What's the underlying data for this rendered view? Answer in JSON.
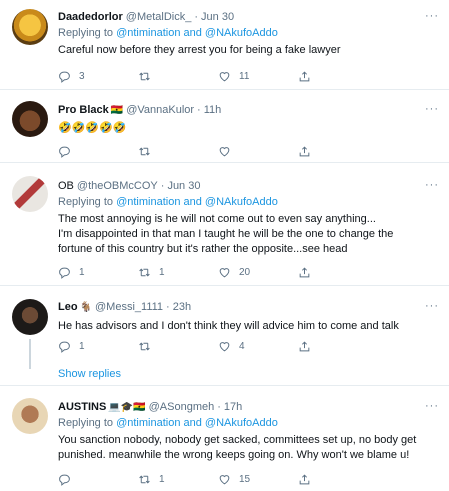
{
  "tweets": [
    {
      "name": "Daadedorlor",
      "handle": "@MetalDick_",
      "dot": "·",
      "date": "Jun 30",
      "replying_prefix": "Replying to ",
      "replying_to": "@ntimination and @NAkufoAddo",
      "text": "Careful now before they arrest you for being a fake lawyer",
      "replies": "3",
      "retweets": "",
      "likes": "11"
    },
    {
      "name": "Pro Black",
      "name_emoji": "🇬🇭",
      "handle": "@VannaKulor",
      "dot": "·",
      "date": "11h",
      "text": "🤣🤣🤣🤣🤣",
      "replies": "",
      "retweets": "",
      "likes": ""
    },
    {
      "name": "OB",
      "handle": "@theOBMcCOY",
      "dot": "·",
      "date": "Jun 30",
      "replying_prefix": "Replying to ",
      "replying_to": "@ntimination and @NAkufoAddo",
      "text_lines": [
        "The most annoying is he will not come out to even say anything...",
        "I'm disappointed in that man I taught he will be the one to change the",
        "fortune of this country but it's rather the opposite...see head"
      ],
      "replies": "1",
      "retweets": "1",
      "likes": "20"
    },
    {
      "name": "Leo",
      "name_emoji": "🐐",
      "handle": "@Messi_1111",
      "dot": "·",
      "date": "23h",
      "text": "He has advisors and I don't think they will advice him to come and talk",
      "replies": "1",
      "retweets": "",
      "likes": "4"
    },
    {
      "name": "AUSTINS",
      "name_emoji": "💻🎓🇬🇭",
      "handle": "@ASongmeh",
      "dot": "·",
      "date": "17h",
      "replying_prefix": "Replying to ",
      "replying_to": "@ntimination and @NAkufoAddo",
      "text_lines": [
        "You sanction nobody, nobody get sacked, committees set up, no body get",
        "punished. meanwhile the wrong keeps going on. Why won't we  blame u!"
      ],
      "replies": "",
      "retweets": "1",
      "likes": "15"
    }
  ],
  "show_replies": "Show replies",
  "more_glyph": "···",
  "colors": {
    "link": "#1b95e0",
    "secondary": "#5b7083",
    "divider": "#e6ecf0"
  },
  "icons": [
    "reply-icon",
    "retweet-icon",
    "like-icon",
    "share-icon",
    "more-icon"
  ]
}
